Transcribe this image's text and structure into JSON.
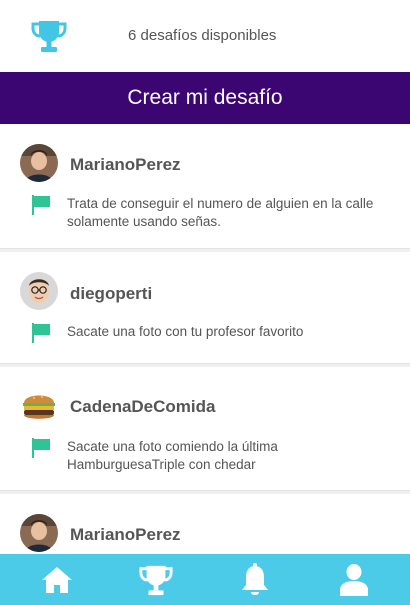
{
  "header": {
    "trophy_icon": "trophy-icon",
    "available_text": "6 desafíos disponibles"
  },
  "create_button": {
    "label": "Crear mi desafío"
  },
  "challenges": [
    {
      "username": "MarianoPerez",
      "avatar": "man-photo-avatar",
      "description": "Trata de conseguir el numero de alguien en la calle solamente usando señas."
    },
    {
      "username": "diegoperti",
      "avatar": "man-with-glasses-avatar",
      "description": "Sacate una foto con tu profesor favorito"
    },
    {
      "username": "CadenaDeComida",
      "avatar": "burger-avatar",
      "description": "Sacate una foto comiendo la última HamburguesaTriple con chedar"
    },
    {
      "username": "MarianoPerez",
      "avatar": "man-photo-avatar",
      "description": ""
    }
  ],
  "bottom_nav": [
    {
      "icon": "home-icon"
    },
    {
      "icon": "trophy-icon"
    },
    {
      "icon": "bell-icon"
    },
    {
      "icon": "user-icon"
    }
  ],
  "colors": {
    "accent_purple": "#3c0672",
    "nav_cyan": "#4ccbe8",
    "flag_green": "#2fc495",
    "trophy_cyan": "#42c6e6"
  }
}
